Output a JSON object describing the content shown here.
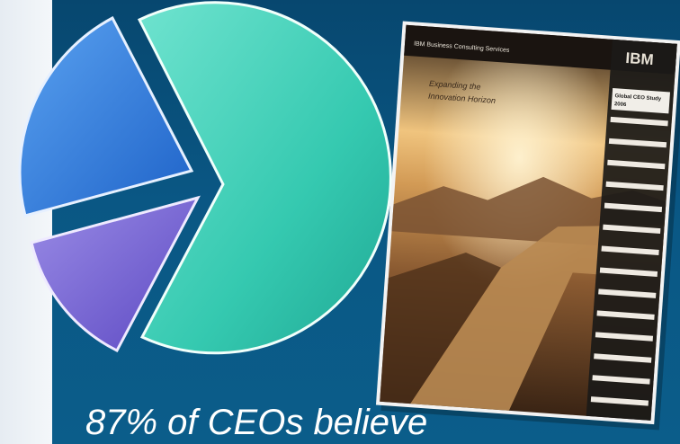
{
  "caption": "87% of CEOs believe",
  "report_cover": {
    "header": "IBM Business Consulting Services",
    "brand": "IBM",
    "title_line1": "Expanding the",
    "title_line2": "Innovation Horizon",
    "sidebar_line1": "Global CEO Study",
    "sidebar_line2": "2006"
  },
  "colors": {
    "background": "#0a5784",
    "pie_large": "#3fd0b8",
    "pie_blue": "#2f7fe0",
    "pie_purple": "#7a68d8"
  }
}
